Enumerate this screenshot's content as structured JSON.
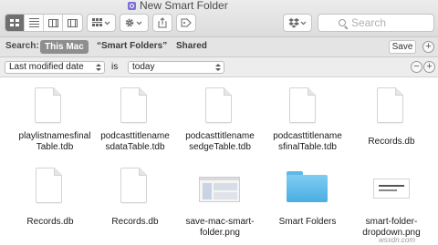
{
  "window": {
    "title": "New Smart Folder"
  },
  "toolbar": {
    "view_buttons": [
      "icon-view",
      "list-view",
      "column-view",
      "cover-flow-view"
    ],
    "search_placeholder": "Search"
  },
  "scope_bar": {
    "label": "Search:",
    "scopes": [
      "This Mac",
      "“Smart Folders”",
      "Shared"
    ],
    "active_scope": "This Mac",
    "save_label": "Save"
  },
  "criteria": {
    "attribute": "Last modified date",
    "operator": "is",
    "value": "today"
  },
  "files": [
    {
      "name": "playlistnamesfinal Table.tdb",
      "line1": "playlistnamesfinal",
      "line2": "Table.tdb",
      "kind": "document"
    },
    {
      "name": "podcasttitlename sdataTable.tdb",
      "line1": "podcasttitlename",
      "line2": "sdataTable.tdb",
      "kind": "document"
    },
    {
      "name": "podcasttitlename sedgeTable.tdb",
      "line1": "podcasttitlename",
      "line2": "sedgeTable.tdb",
      "kind": "document"
    },
    {
      "name": "podcasttitlename sfinalTable.tdb",
      "line1": "podcasttitlename",
      "line2": "sfinalTable.tdb",
      "kind": "document"
    },
    {
      "name": "Records.db",
      "line1": "Records.db",
      "line2": "",
      "kind": "document"
    },
    {
      "name": "Records.db",
      "line1": "Records.db",
      "line2": "",
      "kind": "document"
    },
    {
      "name": "Records.db",
      "line1": "Records.db",
      "line2": "",
      "kind": "document"
    },
    {
      "name": "save-mac-smart- folder.png",
      "line1": "save-mac-smart-",
      "line2": "folder.png",
      "kind": "image"
    },
    {
      "name": "Smart Folders",
      "line1": "Smart Folders",
      "line2": "",
      "kind": "folder"
    },
    {
      "name": "smart-folder-dropdown.png",
      "line1": "smart-folder-",
      "line2": "dropdown.png",
      "kind": "image"
    }
  ],
  "watermark": "wsxdn.com",
  "colors": {
    "folder": "#4aaee2",
    "active_scope": "#8e8e8e",
    "title_icon": "#7b6fd6"
  }
}
